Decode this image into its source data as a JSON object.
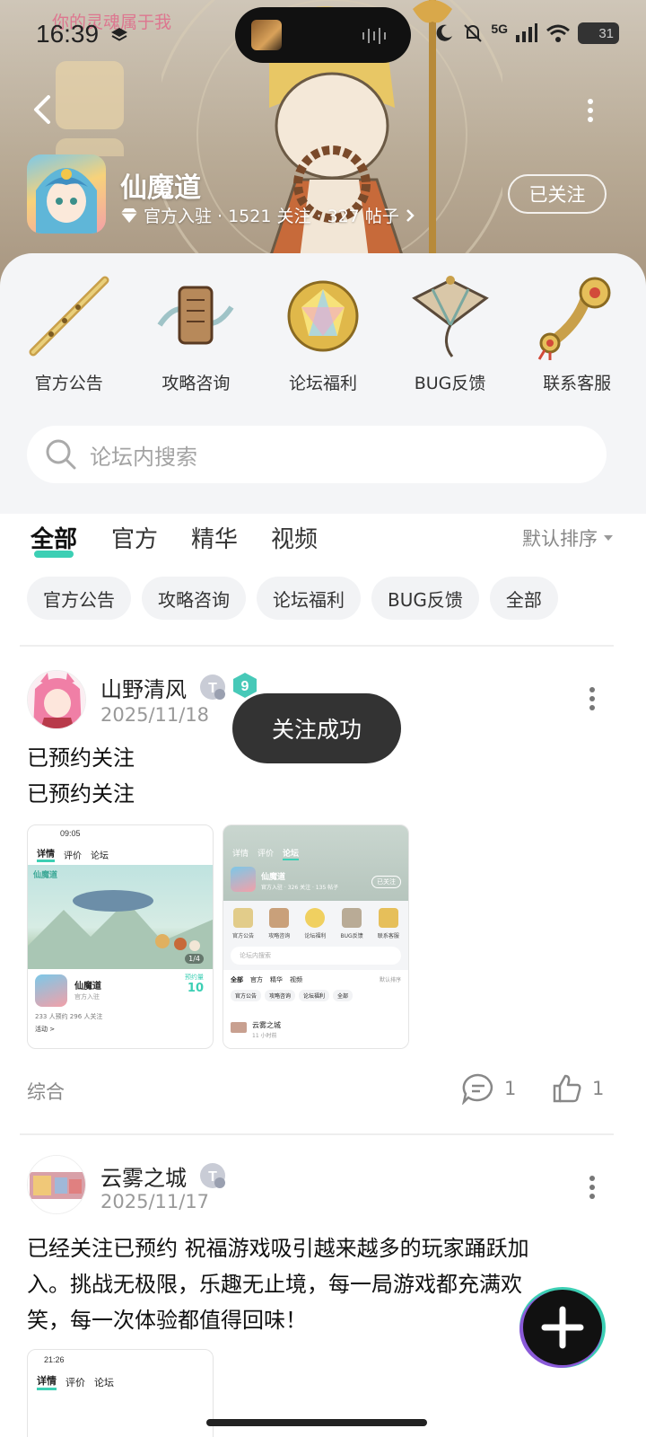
{
  "status_bar": {
    "time": "16:39",
    "network": "5G",
    "battery": "31",
    "watermark": "你的灵魂属于我"
  },
  "forum": {
    "name": "仙魔道",
    "verified": "官方入驻",
    "meta": "· 1521 关注 · 327 帖子",
    "follow_label": "已关注"
  },
  "categories": [
    {
      "label": "官方公告",
      "icon": "flute-icon"
    },
    {
      "label": "攻略咨询",
      "icon": "scroll-icon"
    },
    {
      "label": "论坛福利",
      "icon": "gem-icon"
    },
    {
      "label": "BUG反馈",
      "icon": "kite-icon"
    },
    {
      "label": "联系客服",
      "icon": "ruyi-icon"
    }
  ],
  "search": {
    "placeholder": "论坛内搜索"
  },
  "tabs": [
    {
      "label": "全部",
      "active": true
    },
    {
      "label": "官方"
    },
    {
      "label": "精华"
    },
    {
      "label": "视频"
    }
  ],
  "sort_label": "默认排序",
  "chips": [
    "官方公告",
    "攻略咨询",
    "论坛福利",
    "BUG反馈",
    "全部"
  ],
  "toast": "关注成功",
  "posts": [
    {
      "author": "山野清风",
      "date": "2025/11/18",
      "lines": [
        "已预约关注",
        "已预约关注"
      ],
      "tag": "综合",
      "comments": "1",
      "likes": "1",
      "level_badge": "9"
    },
    {
      "author": "云雾之城",
      "date": "2025/11/17",
      "lines": [
        "已经关注已预约 祝福游戏吸引越来越多的玩家踊跃加",
        "入。挑战无极限，乐趣无止境，每一局游戏都充满欢",
        "笑，每一次体验都值得回味！"
      ]
    }
  ],
  "thumb1": {
    "time": "09:05",
    "tabs": [
      "详情",
      "评价",
      "论坛"
    ],
    "banner_label": "仙魔道",
    "page": "1/4",
    "name": "仙魔道",
    "sub": "官方入驻",
    "reserve_label": "预约量",
    "reserve_value": "10",
    "stats": "233 人预约  296 人关注",
    "activity": "活动 >"
  },
  "thumb2": {
    "tabs": [
      "详情",
      "评价",
      "论坛"
    ],
    "name": "仙魔道",
    "meta": "官方入驻 · 326 关注 · 135 帖子",
    "follow": "已关注",
    "cats": [
      "官方公告",
      "攻略咨询",
      "论坛福利",
      "BUG反馈",
      "联系客服"
    ],
    "search": "论坛内搜索",
    "tabs2": [
      "全部",
      "官方",
      "精华",
      "视频"
    ],
    "sort": "默认排序",
    "chips": [
      "官方公告",
      "攻略咨询",
      "论坛福利",
      "全部"
    ],
    "post_name": "云雾之城",
    "post_time": "11 小时前"
  },
  "thumb3": {
    "time": "21:26",
    "tabs": [
      "详情",
      "评价",
      "论坛"
    ]
  },
  "colors": {
    "accent": "#3ccfb4",
    "toast_bg": "#333333",
    "panel_bg": "#f4f5f7"
  }
}
